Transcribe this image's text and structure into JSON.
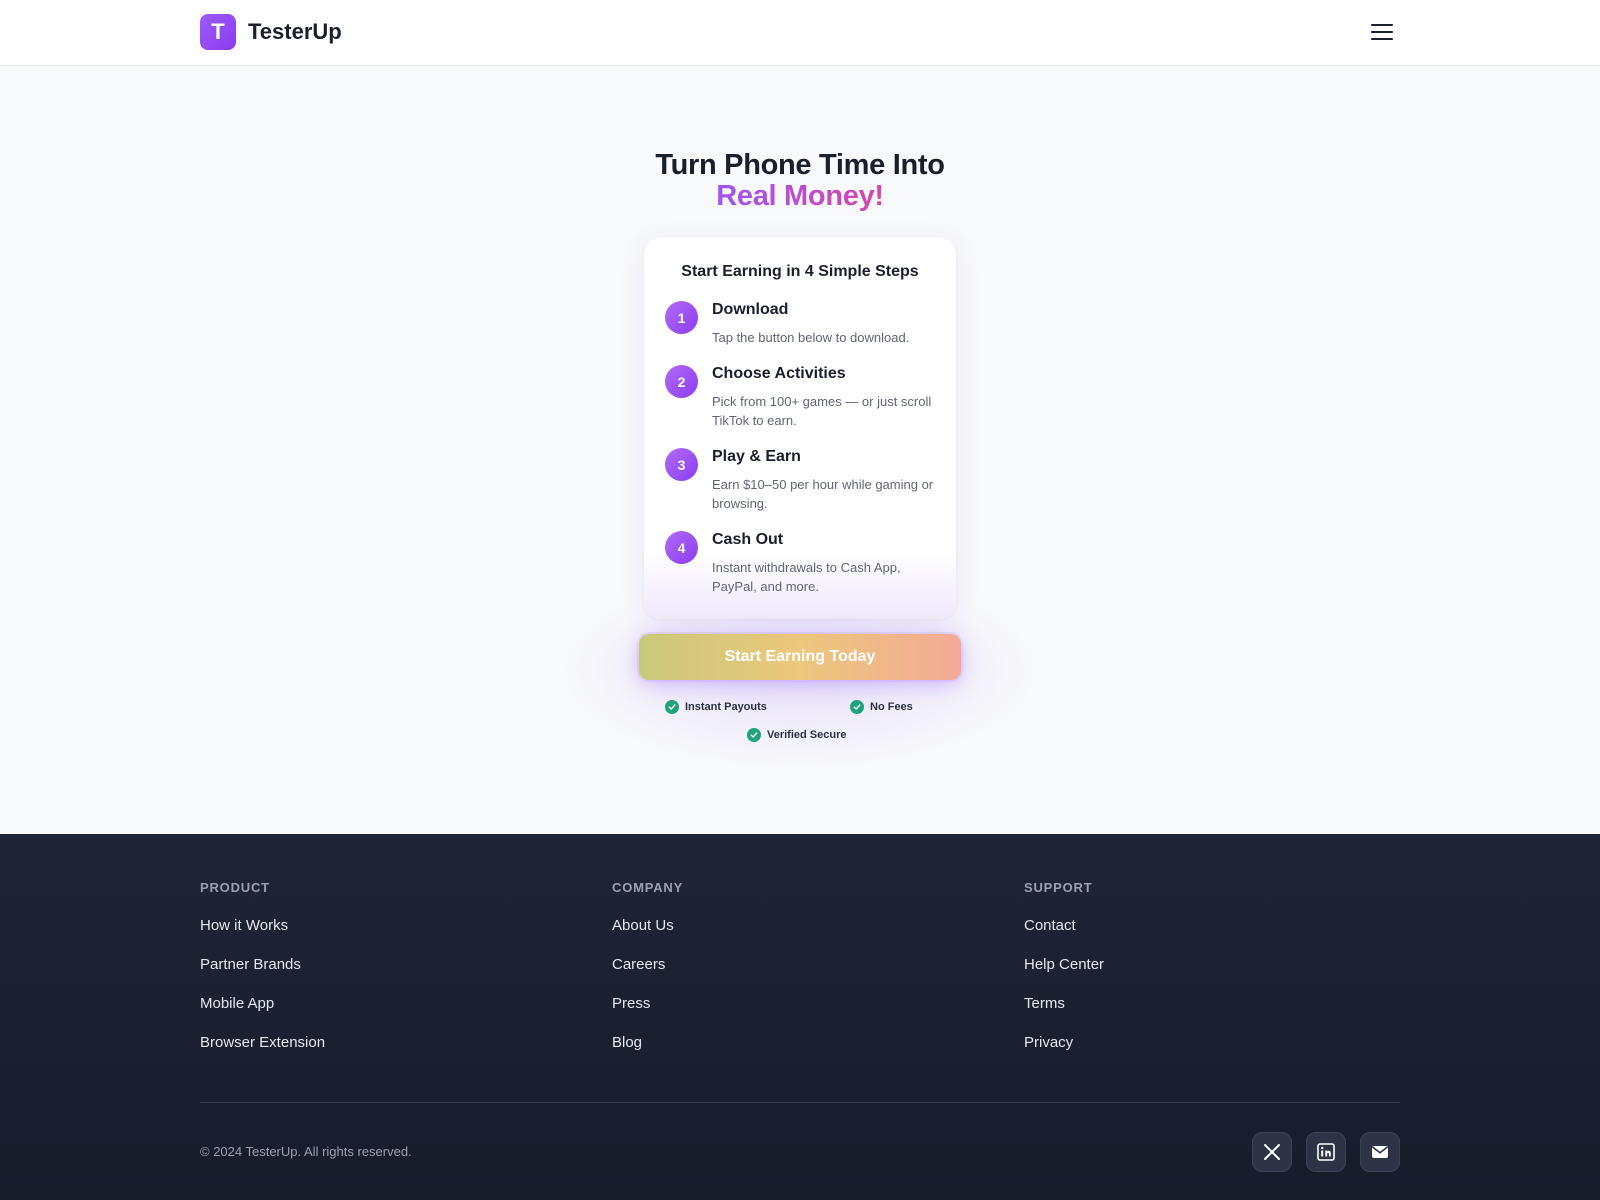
{
  "header": {
    "logo_letter": "T",
    "brand_name": "TesterUp",
    "menu_icon": "hamburger-menu-icon"
  },
  "hero": {
    "title_line1": "Turn Phone Time Into",
    "title_line2": "Real Money!"
  },
  "steps_card": {
    "heading": "Start Earning in 4 Simple Steps",
    "steps": [
      {
        "number": "1",
        "title": "Download",
        "desc": "Tap the button below to download."
      },
      {
        "number": "2",
        "title": "Choose Activities",
        "desc": "Pick from 100+ games — or just scroll TikTok to earn."
      },
      {
        "number": "3",
        "title": "Play & Earn",
        "desc": "Earn $10–50 per hour while gaming or browsing."
      },
      {
        "number": "4",
        "title": "Cash Out",
        "desc": "Instant withdrawals to Cash App, PayPal, and more."
      }
    ]
  },
  "cta": {
    "label": "Start Earning Today"
  },
  "trust_badges": [
    "Instant Payouts",
    "No Fees",
    "Verified Secure"
  ],
  "footer": {
    "columns": [
      {
        "title": "PRODUCT",
        "links": [
          "How it Works",
          "Partner Brands",
          "Mobile App",
          "Browser Extension"
        ]
      },
      {
        "title": "COMPANY",
        "links": [
          "About Us",
          "Careers",
          "Press",
          "Blog"
        ]
      },
      {
        "title": "SUPPORT",
        "links": [
          "Contact",
          "Help Center",
          "Terms",
          "Privacy"
        ]
      }
    ],
    "copyright": "© 2024 TesterUp. All rights reserved.",
    "social_icons": [
      "x-icon",
      "linkedin-icon",
      "mail-icon"
    ]
  },
  "colors": {
    "brand_purple": "#8b3cf0",
    "accent_pink": "#d646a8",
    "check_green": "#1fa37a",
    "footer_bg": "#1e2536"
  }
}
